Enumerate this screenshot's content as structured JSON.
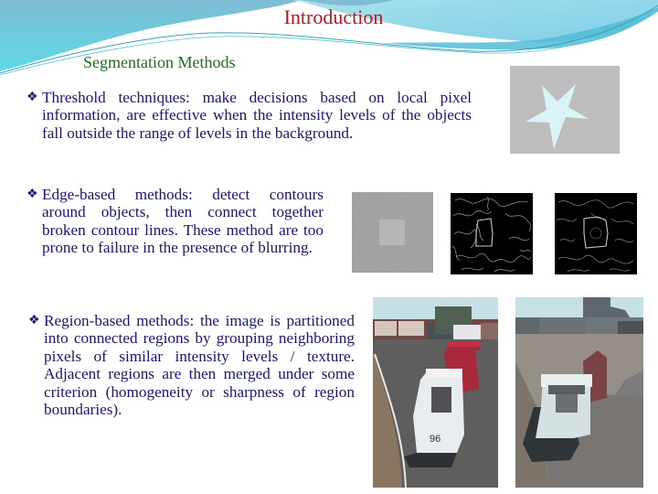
{
  "slide": {
    "title": "Introduction",
    "subtitle": "Segmentation Methods",
    "bullet_glyph": "❖",
    "colors": {
      "title": "#c0141e",
      "subtitle": "#1e6e1e",
      "body_text": "#17177a",
      "header_wave": "#7fc6da"
    },
    "bullets": [
      {
        "term": "Threshold techniques:",
        "text": "Threshold techniques: make decisions based on local pixel information, are effective when the intensity levels of the objects fall outside the range of levels in the background."
      },
      {
        "term": "Edge-based methods:",
        "text": "Edge-based methods: detect contours around objects, then connect together broken contour lines. These method are too prone to failure in the presence of blurring."
      },
      {
        "term": "Region-based methods:",
        "text": "Region-based methods: the image is partitioned into connected regions by grouping neighboring pixels of similar intensity levels / texture. Adjacent regions are then merged under some criterion (homogeneity or sharpness of region boundaries)."
      }
    ],
    "figures": [
      {
        "name": "threshold-star-image",
        "description": "light cyan star on gray background"
      },
      {
        "name": "noisy-square-image",
        "description": "noisy gray image with brighter square"
      },
      {
        "name": "edge-map-1",
        "description": "edge detection result with many contours"
      },
      {
        "name": "edge-map-2",
        "description": "smoothed edge detection result with square contour"
      },
      {
        "name": "race-car-photo",
        "description": "race cars on track, car number 96"
      },
      {
        "name": "region-segmentation-result",
        "description": "flat-colored region segmentation of race car photo"
      }
    ],
    "car_number": "96"
  }
}
